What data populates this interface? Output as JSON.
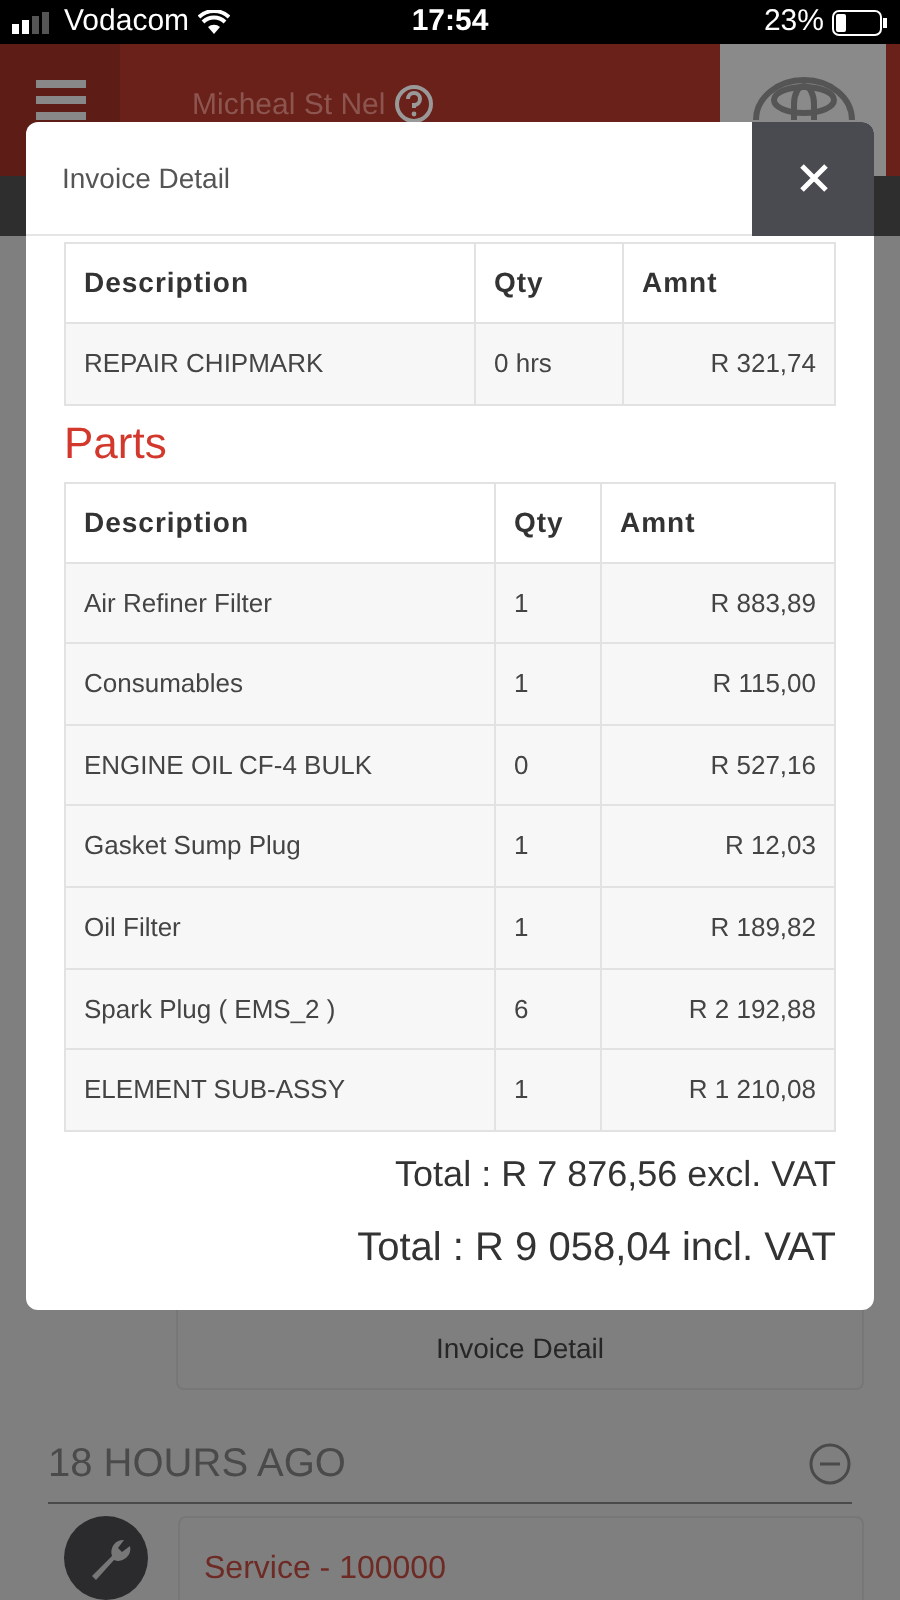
{
  "status_bar": {
    "carrier": "Vodacom",
    "time": "17:54",
    "battery": "23%"
  },
  "header": {
    "user": "Micheal St Nel"
  },
  "modal": {
    "title": "Invoice Detail",
    "labour_table": {
      "columns": [
        "Description",
        "Qty",
        "Amnt"
      ],
      "rows": [
        [
          "REPAIR CHIPMARK",
          "0 hrs",
          "R 321,74"
        ]
      ]
    },
    "parts_heading": "Parts",
    "parts_table": {
      "columns": [
        "Description",
        "Qty",
        "Amnt"
      ],
      "rows": [
        [
          "Air Refiner Filter",
          "1",
          "R 883,89"
        ],
        [
          "Consumables",
          "1",
          "R 115,00"
        ],
        [
          "ENGINE OIL CF-4 BULK",
          "0",
          "R 527,16"
        ],
        [
          "Gasket Sump Plug",
          "1",
          "R 12,03"
        ],
        [
          "Oil Filter",
          "1",
          "R 189,82"
        ],
        [
          "Spark Plug ( EMS_2 )",
          "6",
          "R 2 192,88"
        ],
        [
          "ELEMENT SUB-ASSY",
          "1",
          "R 1 210,08"
        ]
      ]
    },
    "totals": [
      "Total : R 7 876,56 excl. VAT",
      "Total : R 9 058,04 incl. VAT"
    ]
  },
  "background": {
    "button": "Invoice Detail",
    "section_heading": "18 HOURS AGO",
    "entry_title": "Service - 100000"
  }
}
